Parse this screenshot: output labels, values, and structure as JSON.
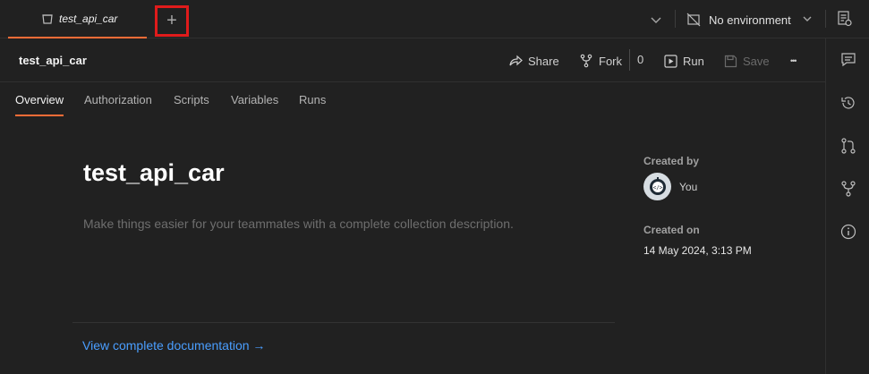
{
  "tabbar": {
    "tab_label": "test_api_car",
    "new_tab_symbol": "+",
    "environment_label": "No environment",
    "icons": [
      "collection-icon",
      "plus-icon",
      "chevron-down-icon",
      "no-environment-icon",
      "environment-settings-icon"
    ]
  },
  "header": {
    "collection_name": "test_api_car",
    "share_label": "Share",
    "fork_label": "Fork",
    "fork_count": "0",
    "run_label": "Run",
    "save_label": "Save",
    "more_symbol": "•••"
  },
  "subtabs": [
    "Overview",
    "Authorization",
    "Scripts",
    "Variables",
    "Runs"
  ],
  "overview": {
    "title": "test_api_car",
    "description_placeholder": "Make things easier for your teammates with a complete collection description.",
    "doc_link": "View complete documentation →"
  },
  "meta": {
    "created_by_label": "Created by",
    "creator": "You",
    "created_on_label": "Created on",
    "created_on": "14 May 2024, 3:13 PM"
  },
  "rightbar_icons": [
    "comments-icon",
    "history-icon",
    "pull-request-icon",
    "fork-icon",
    "info-icon"
  ],
  "colors": {
    "background": "#212121",
    "accent": "#ff6c37",
    "link": "#4a9eff",
    "highlight_box": "#e01b1b"
  }
}
